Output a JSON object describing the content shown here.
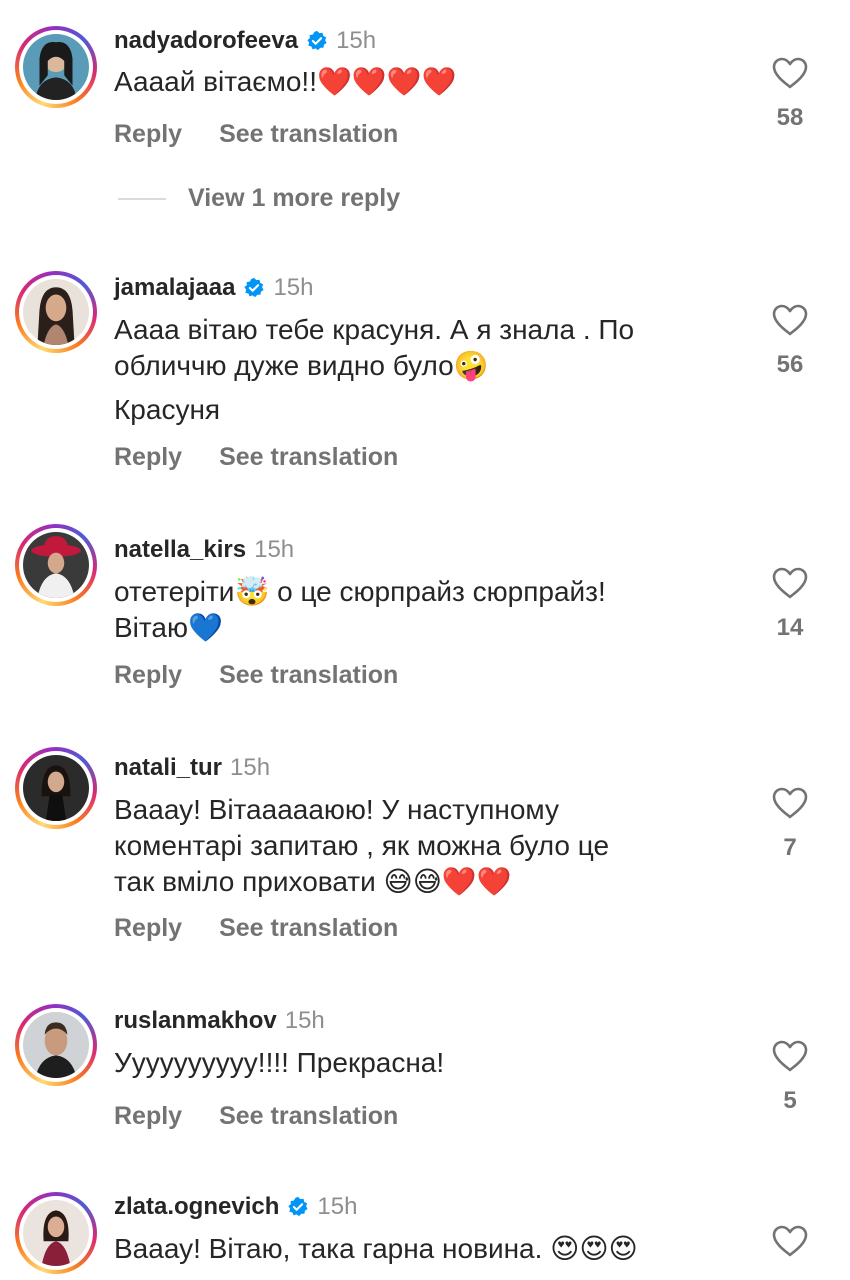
{
  "comments": [
    {
      "username": "nadyadorofeeva",
      "verified": true,
      "time": "15h",
      "lines": [
        "Аааай вітаємо!!❤️❤️❤️❤️"
      ],
      "likes": "58",
      "reply": "Reply",
      "translate": "See translation"
    },
    {
      "username": "jamalajaaa",
      "verified": true,
      "time": "15h",
      "lines": [
        "Аааа вітаю тебе красуня. А я знала . По",
        "обличчю дуже видно було🤪",
        "Красуня"
      ],
      "likes": "56",
      "reply": "Reply",
      "translate": "See translation"
    },
    {
      "username": "natella_kirs",
      "verified": false,
      "time": "15h",
      "lines": [
        "отетеріти🤯 о це сюрпрайз сюрпрайз!",
        "Вітаю💙"
      ],
      "likes": "14",
      "reply": "Reply",
      "translate": "See translation"
    },
    {
      "username": "natali_tur",
      "verified": false,
      "time": "15h",
      "lines": [
        "Вааау! Вітаааааюю! У наступному",
        "коментарі запитаю , як можна було це",
        "так вміло приховати 😅😅❤️❤️"
      ],
      "likes": "7",
      "reply": "Reply",
      "translate": "See translation"
    },
    {
      "username": "ruslanmakhov",
      "verified": false,
      "time": "15h",
      "lines": [
        "Уууууууууу!!!! Прекрасна!"
      ],
      "likes": "5",
      "reply": "Reply",
      "translate": "See translation"
    },
    {
      "username": "zlata.ognevich",
      "verified": true,
      "time": "15h",
      "lines": [
        "Вааау! Вітаю, така гарна новина. 😍😍😍"
      ],
      "likes": "",
      "reply": "",
      "translate": ""
    }
  ],
  "view_more": "View 1 more reply",
  "colors": {
    "text": "#262626",
    "secondary": "#737373",
    "verified": "#0095f6"
  }
}
